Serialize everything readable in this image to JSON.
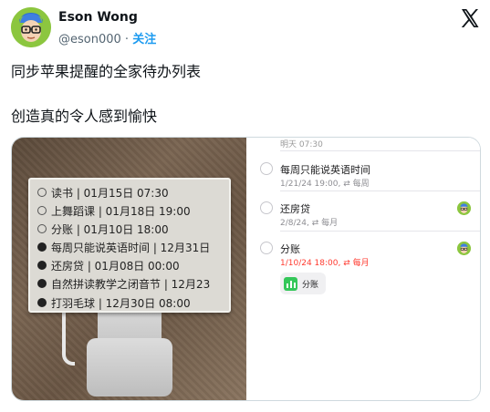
{
  "author": {
    "name": "Eson Wong",
    "handle": "@eson000",
    "separator": "·",
    "follow_label": "关注"
  },
  "icons": {
    "avatar": "avatar-glasses-cartoon",
    "x_logo": "x-logo-icon"
  },
  "tweet": {
    "line1": "同步苹果提醒的全家待办列表",
    "line2": "创造真的令人感到愉快"
  },
  "eink_rows": [
    {
      "text": "读书 | 01月15日 07:30",
      "done": false
    },
    {
      "text": "上舞蹈课 | 01月18日 19:00",
      "done": false
    },
    {
      "text": "分账 | 01月10日 18:00",
      "done": false
    },
    {
      "text": "每周只能说英语时间 | 12月31日",
      "done": true
    },
    {
      "text": "还房贷 | 01月08日 00:00",
      "done": true
    },
    {
      "text": "自然拼读教学之闭音节 | 12月23",
      "done": true
    },
    {
      "text": "打羽毛球 | 12月30日 08:00",
      "done": true
    }
  ],
  "reminders": {
    "top_fragment": "明天 07:30",
    "items": [
      {
        "title": "每周只能说英语时间",
        "date": "1/21/24 19:00",
        "repeat": "每周",
        "overdue": false
      },
      {
        "title": "还房贷",
        "date": "2/8/24",
        "repeat": "每月",
        "overdue": false
      },
      {
        "title": "分账",
        "date": "1/10/24 18:00",
        "repeat": "每月",
        "overdue": true
      }
    ],
    "chip_label": "分账",
    "repeat_symbol": "⇄"
  },
  "colors": {
    "accent": "#1d9bf0",
    "overdue": "#ff3b30",
    "chip_green": "#34c759"
  }
}
